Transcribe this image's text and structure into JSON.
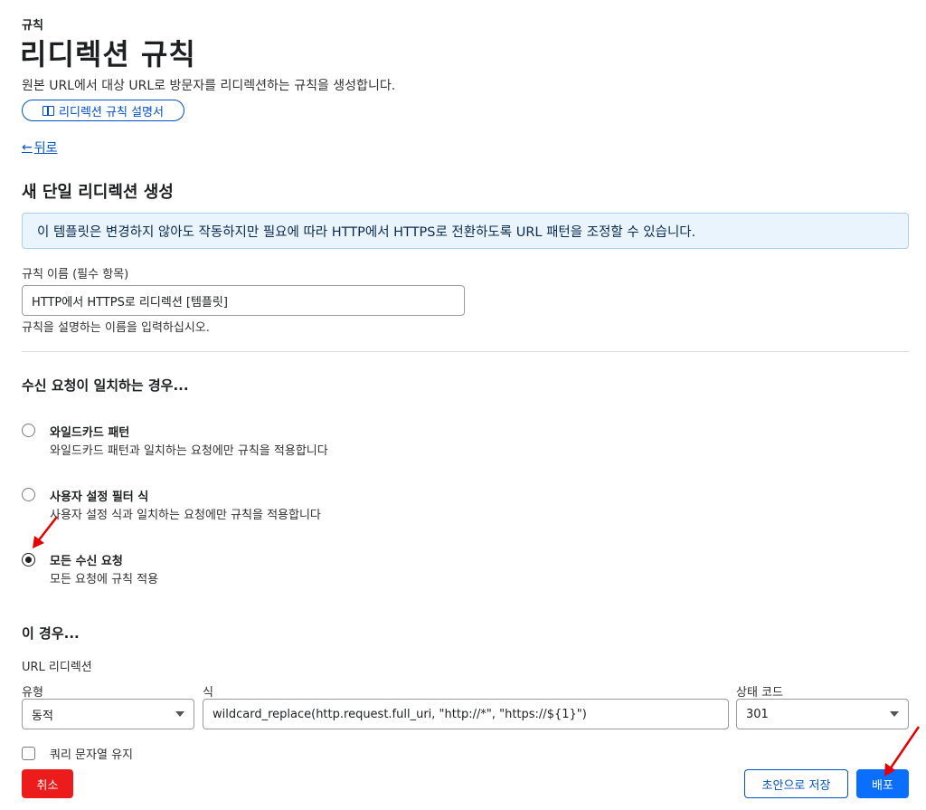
{
  "header": {
    "eyebrow": "규칙",
    "title": "리디렉션 규칙",
    "description": "원본 URL에서 대상 URL로 방문자를 리디렉션하는 규칙을 생성합니다.",
    "docs_button": "리디렉션 규칙 설명서",
    "back_arrow": "←",
    "back_link": "뒤로"
  },
  "form": {
    "section_title": "새 단일 리디렉션 생성",
    "info_banner": "이 템플릿은 변경하지 않아도 작동하지만 필요에 따라 HTTP에서 HTTPS로 전환하도록 URL 패턴을 조정할 수 있습니다.",
    "rule_name_label": "규칙 이름 (필수 항목)",
    "rule_name_value": "HTTP에서 HTTPS로 리디렉션 [템플릿]",
    "rule_name_help": "규칙을 설명하는 이름을 입력하십시오."
  },
  "match": {
    "title": "수신 요청이 일치하는 경우...",
    "options": [
      {
        "label": "와일드카드 패턴",
        "desc": "와일드카드 패턴과 일치하는 요청에만 규칙을 적용합니다",
        "checked": false
      },
      {
        "label": "사용자 설정 필터 식",
        "desc": "사용자 설정 식과 일치하는 요청에만 규칙을 적용합니다",
        "checked": false
      },
      {
        "label": "모든 수신 요청",
        "desc": "모든 요청에 규칙 적용",
        "checked": true
      }
    ]
  },
  "then": {
    "title": "이 경우...",
    "redirect_label": "URL 리디렉션",
    "type_label": "유형",
    "type_value": "동적",
    "expression_label": "식",
    "expression_value": "wildcard_replace(http.request.full_uri, \"http://*\", \"https://${1}\")",
    "status_label": "상태 코드",
    "status_value": "301",
    "preserve_query_label": "쿼리 문자열 유지"
  },
  "actions": {
    "cancel": "취소",
    "save_draft": "초안으로 저장",
    "deploy": "배포"
  },
  "colors": {
    "accent_blue": "#0051c3",
    "deploy_blue": "#0a6eff",
    "cancel_red": "#ec1c1c",
    "annotation_arrow": "#e60000"
  }
}
